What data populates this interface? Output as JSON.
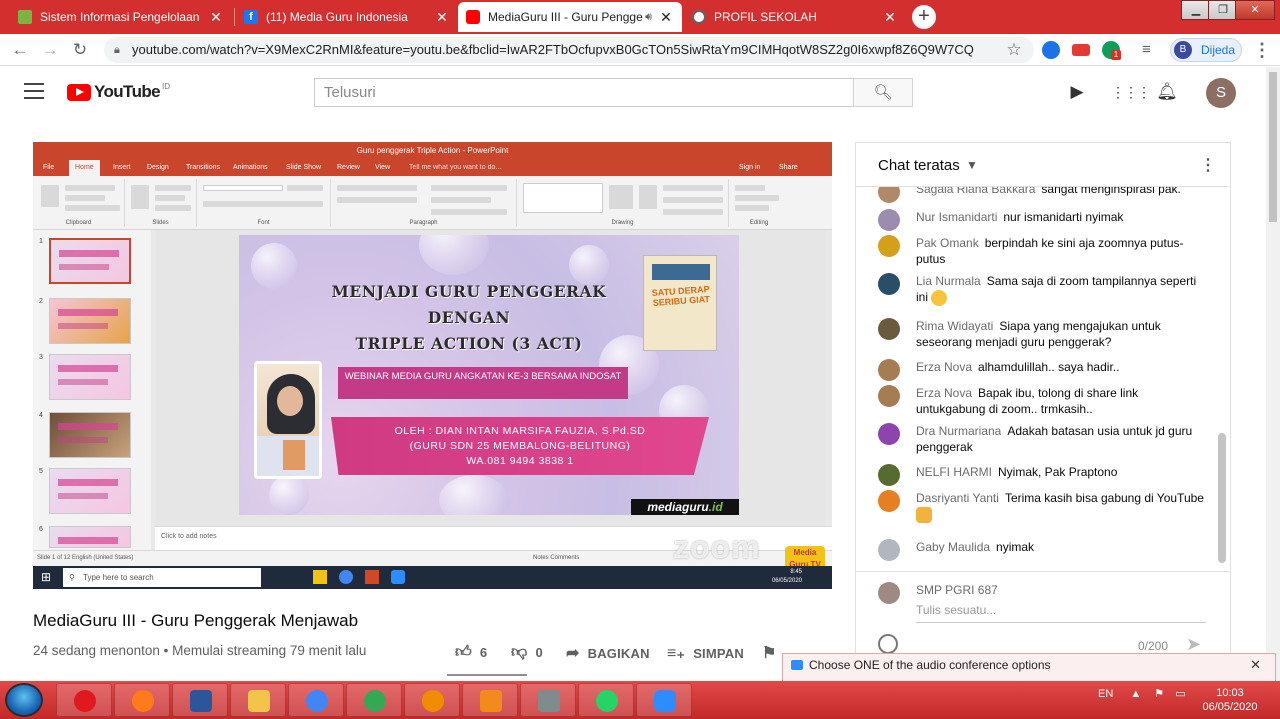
{
  "browser": {
    "tabs": [
      {
        "title": "Sistem Informasi Pengelolaan Ke",
        "favicon_color": "#7cb342",
        "active": false
      },
      {
        "title": "(11) Media Guru Indonesia",
        "favicon_color": "#1877f2",
        "active": false
      },
      {
        "title": "MediaGuru III - Guru Pengge",
        "favicon_color": "#ff0000",
        "active": true
      },
      {
        "title": "PROFIL SEKOLAH",
        "favicon_color": "#5f6368",
        "active": false
      }
    ],
    "new_tab_label": "+",
    "url": "youtube.com/watch?v=X9MexC2RnMI&feature=youtu.be&fbclid=IwAR2FTbOcfupvxB0GcTOn5SiwRtaYm9CIMHqotW8SZ2g0I6xwpf8Z6Q9W7CQ",
    "profile": {
      "initial": "B",
      "name": "Dijeda"
    },
    "ext_badge": "1"
  },
  "youtube": {
    "logo_text": "YouTube",
    "region": "ID",
    "search_placeholder": "Telusuri",
    "avatar_initial": "S"
  },
  "video": {
    "title": "MediaGuru III - Guru Penggerak Menjawab",
    "meta": "24 sedang menonton • Memulai streaming 79 menit lalu",
    "likes": "6",
    "dislikes": "0",
    "share_label": "BAGIKAN",
    "save_label": "SIMPAN"
  },
  "powerpoint": {
    "window_title": "Guru penggerak Triple Action - PowerPoint",
    "ribbon_tabs": [
      "File",
      "Home",
      "Insert",
      "Design",
      "Transitions",
      "Animations",
      "Slide Show",
      "Review",
      "View",
      "Tell me what you want to do..."
    ],
    "signin": "Sign in",
    "share": "Share",
    "groups": [
      "Clipboard",
      "Slides",
      "Font",
      "Paragraph",
      "Drawing",
      "Editing"
    ],
    "thumb_numbers": [
      "1",
      "2",
      "3",
      "4",
      "5",
      "6"
    ],
    "notes_placeholder": "Click to add notes",
    "status_left": "Slide 1 of 12    English (United States)",
    "status_right": "Notes   Comments",
    "zoom_watermark": "zoom",
    "mgtv_label": "Media Guru TV",
    "taskbar_search": "Type here to search",
    "win_time": "8:45",
    "win_date": "06/05/2020"
  },
  "slide": {
    "title_line1": "MENJADI GURU PENGGERAK DENGAN",
    "title_line2": "TRIPLE ACTION (3 ACT)",
    "book_title": "SATU DERAP SERIBU GIAT",
    "webinar": "WEBINAR MEDIA GURU ANGKATAN KE-3 BERSAMA INDOSAT",
    "author_line1": "OLEH : DIAN INTAN MARSIFA FAUZIA, S.Pd.SD",
    "author_line2": "(GURU SDN 25 MEMBALONG-BELITUNG)",
    "author_line3": "WA.081 9494 3838  1",
    "brand_prefix": "mediaguru",
    "brand_suffix": ".id"
  },
  "chat": {
    "header": "Chat teratas",
    "messages": [
      {
        "name": "Sagala Riana Bakkara",
        "text": "sangat menginspirasi pak.",
        "avatar": "#b08968"
      },
      {
        "name": "Nur Ismanidarti",
        "text": "nur ismanidarti nyimak",
        "avatar": "#9c8db0"
      },
      {
        "name": "Pak Omank",
        "text": "berpindah ke sini aja zoomnya putus-putus",
        "avatar": "#d4a017"
      },
      {
        "name": "Lia Nurmala",
        "text": "Sama saja di zoom tampilannya seperti ini",
        "avatar": "#2a4d69",
        "emoji": true
      },
      {
        "name": "Rima Widayati",
        "text": "Siapa yang mengajukan untuk seseorang menjadi guru penggerak?",
        "avatar": "#6b5b3e"
      },
      {
        "name": "Erza Nova",
        "text": "alhamdulillah.. saya hadir..",
        "avatar": "#a67c52"
      },
      {
        "name": "Erza Nova",
        "text": "Bapak ibu, tolong di share link untukgabung di zoom.. trmkasih..",
        "avatar": "#a67c52"
      },
      {
        "name": "Dra Nurmariana",
        "text": "Adakah batasan usia untuk jd guru penggerak",
        "avatar": "#8e44ad"
      },
      {
        "name": "NELFI HARMI",
        "text": "Nyimak, Pak Praptono",
        "avatar": "#556b2f"
      },
      {
        "name": "Dasriyanti Yanti",
        "text": "Terima kasih bisa gabung di YouTube",
        "avatar": "#e67e22",
        "emoji": true
      },
      {
        "name": "Gaby Maulida",
        "text": "nyimak",
        "avatar": "#b0b7bf"
      }
    ],
    "input_name": "SMP PGRI 687",
    "input_placeholder": "Tulis sesuatu...",
    "char_count": "0/200"
  },
  "zoom_popup": "Choose ONE of the audio conference options",
  "taskbar": {
    "lang": "EN",
    "time": "10:03",
    "date": "06/05/2020",
    "apps": [
      {
        "name": "opera",
        "color": "#e0191f"
      },
      {
        "name": "firefox",
        "color": "#ff7a1a"
      },
      {
        "name": "word",
        "color": "#2b579a"
      },
      {
        "name": "explorer",
        "color": "#f3c34a"
      },
      {
        "name": "chrome",
        "color": "#4285f4"
      },
      {
        "name": "chrome-profile",
        "color": "#34a853"
      },
      {
        "name": "avast",
        "color": "#f08c00"
      },
      {
        "name": "media-player",
        "color": "#f28b1c"
      },
      {
        "name": "network",
        "color": "#7f8c8d"
      },
      {
        "name": "whatsapp",
        "color": "#25d366"
      },
      {
        "name": "zoom",
        "color": "#2d8cff"
      }
    ]
  }
}
